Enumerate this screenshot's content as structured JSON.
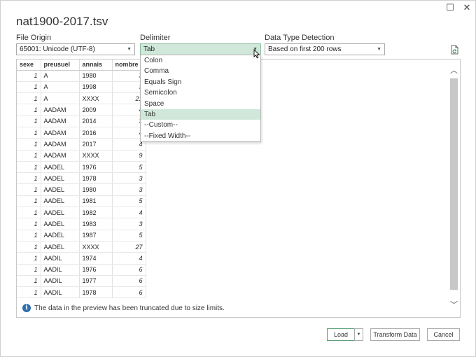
{
  "window": {
    "title": "nat1900-2017.tsv",
    "minimize_glyph": "☐",
    "close_glyph": "✕"
  },
  "file_origin": {
    "label": "File Origin",
    "value": "65001: Unicode (UTF-8)"
  },
  "delimiter": {
    "label": "Delimiter",
    "value": "Tab",
    "options": [
      "Colon",
      "Comma",
      "Equals Sign",
      "Semicolon",
      "Space",
      "Tab",
      "--Custom--",
      "--Fixed Width--"
    ],
    "selected_index": 5
  },
  "data_type_detection": {
    "label": "Data Type Detection",
    "value": "Based on first 200 rows"
  },
  "preview": {
    "columns": [
      "sexe",
      "preusuel",
      "annais",
      "nombre"
    ],
    "rows": [
      [
        "1",
        "A",
        "1980",
        "3"
      ],
      [
        "1",
        "A",
        "1998",
        "3"
      ],
      [
        "1",
        "A",
        "XXXX",
        "21"
      ],
      [
        "1",
        "AADAM",
        "2009",
        "4"
      ],
      [
        "1",
        "AADAM",
        "2014",
        "3"
      ],
      [
        "1",
        "AADAM",
        "2016",
        "4"
      ],
      [
        "1",
        "AADAM",
        "2017",
        "4"
      ],
      [
        "1",
        "AADAM",
        "XXXX",
        "9"
      ],
      [
        "1",
        "AADEL",
        "1976",
        "5"
      ],
      [
        "1",
        "AADEL",
        "1978",
        "3"
      ],
      [
        "1",
        "AADEL",
        "1980",
        "3"
      ],
      [
        "1",
        "AADEL",
        "1981",
        "5"
      ],
      [
        "1",
        "AADEL",
        "1982",
        "4"
      ],
      [
        "1",
        "AADEL",
        "1983",
        "3"
      ],
      [
        "1",
        "AADEL",
        "1987",
        "5"
      ],
      [
        "1",
        "AADEL",
        "XXXX",
        "27"
      ],
      [
        "1",
        "AADIL",
        "1974",
        "4"
      ],
      [
        "1",
        "AADIL",
        "1976",
        "6"
      ],
      [
        "1",
        "AADIL",
        "1977",
        "6"
      ],
      [
        "1",
        "AADIL",
        "1978",
        "6"
      ]
    ],
    "notice": "The data in the preview has been truncated due to size limits."
  },
  "buttons": {
    "load": "Load",
    "load_split": "▼",
    "transform": "Transform Data",
    "cancel": "Cancel"
  },
  "colors": {
    "selection_green": "#cfe8da",
    "info_blue": "#2f6fb0"
  }
}
